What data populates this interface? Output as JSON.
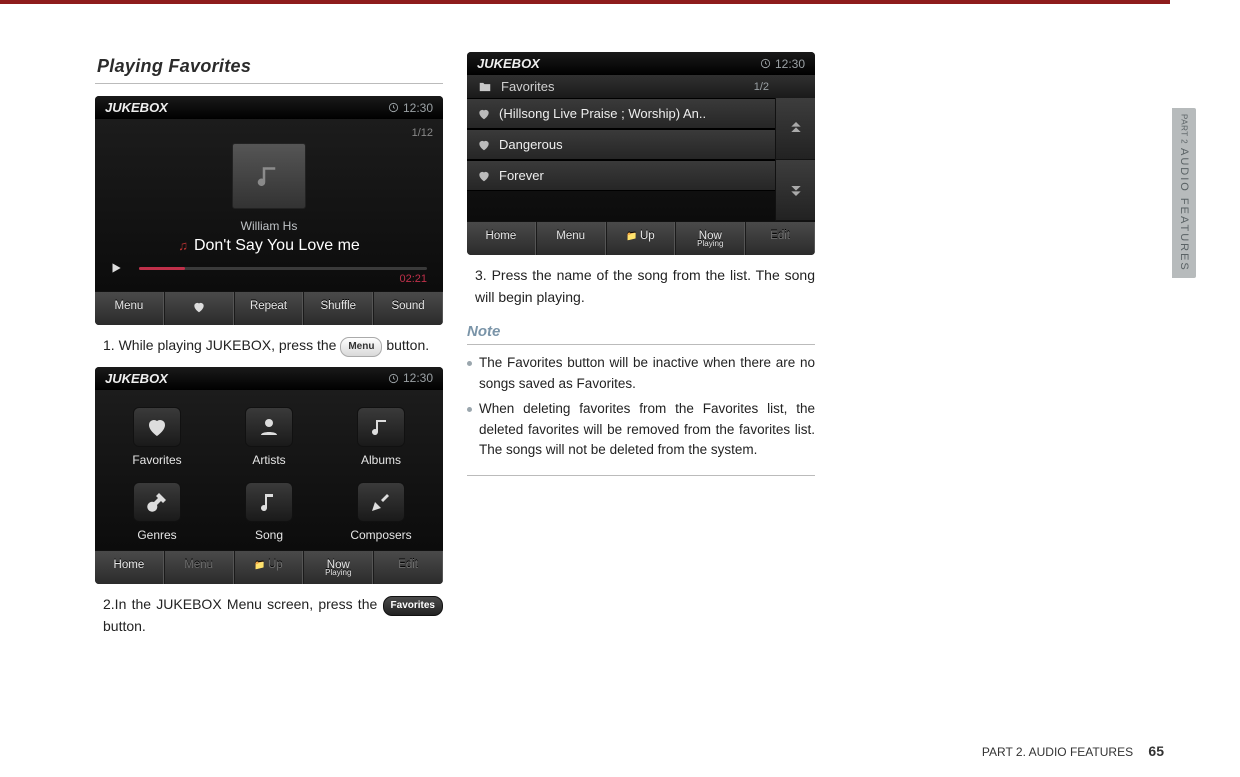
{
  "section_title": "Playing Favorites",
  "steps": {
    "s1_pre": "1. While playing JUKEBOX, press the ",
    "s1_chip": "Menu",
    "s1_post": " button.",
    "s2_pre": "2.In the JUKEBOX Menu screen, press the ",
    "s2_chip": "Favorites",
    "s2_post": " button.",
    "s3": "3. Press the name of the song from the list. The song will begin playing."
  },
  "note_title": "Note",
  "notes": [
    "The Favorites button will be inactive when there are no songs saved as Favorites.",
    "When deleting favorites from the Favorites list, the deleted favorites will be removed from the favorites list. The songs will not be deleted from the system."
  ],
  "shot1": {
    "title": "JUKEBOX",
    "clock": "12:30",
    "pager": "1/12",
    "artist": "William Hs",
    "track": "Don't Say You Love me",
    "time": "02:21",
    "buttons": [
      "Menu",
      "",
      "Repeat",
      "Shuffle",
      "Sound"
    ]
  },
  "shot2": {
    "title": "JUKEBOX",
    "clock": "12:30",
    "items": [
      "Favorites",
      "Artists",
      "Albums",
      "Genres",
      "Song",
      "Composers"
    ],
    "bottom": [
      "Home",
      "Menu",
      "Up",
      "Now",
      "Edit"
    ],
    "bottom_sub": "Playing"
  },
  "shot3": {
    "title": "JUKEBOX",
    "clock": "12:30",
    "folder": "Favorites",
    "pager": "1/2",
    "rows": [
      "(Hillsong Live Praise ; Worship) An..",
      "Dangerous",
      "Forever"
    ],
    "bottom": [
      "Home",
      "Menu",
      "Up",
      "Now",
      "Edit"
    ],
    "bottom_sub": "Playing"
  },
  "sidetab": {
    "part": "PART 2",
    "label": "AUDIO FEATURES"
  },
  "footer": {
    "section": "PART 2. AUDIO FEATURES",
    "page": "65"
  }
}
